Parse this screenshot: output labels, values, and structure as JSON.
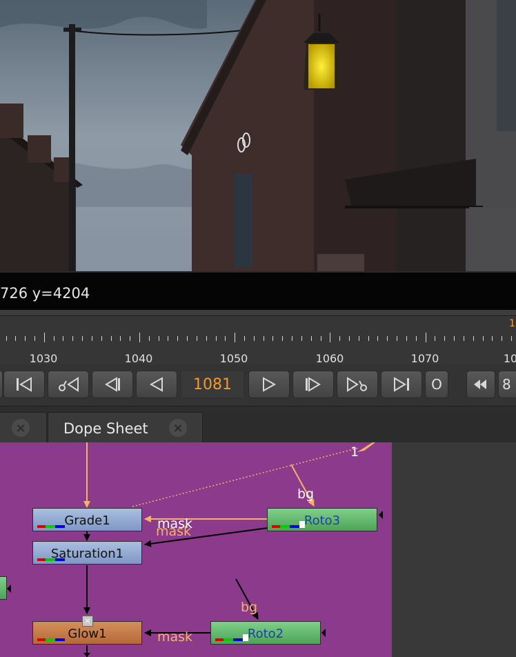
{
  "viewer": {
    "coordinate_readout": "726 y=4204"
  },
  "timeline": {
    "labels": [
      "1030",
      "1040",
      "1050",
      "1060",
      "1070",
      "10"
    ],
    "corner_marker": "1"
  },
  "transport": {
    "current_frame": "1081",
    "o_button": "O",
    "step_value": "8",
    "buttons": [
      "first-frame",
      "prev-keyframe",
      "prev-frame-step",
      "play-backward",
      "play-forward",
      "next-frame-step",
      "next-keyframe",
      "last-frame",
      "o-button",
      "rewind",
      "step-value"
    ]
  },
  "tabs": {
    "dope_sheet": "Dope Sheet"
  },
  "node_graph": {
    "nodes": {
      "grade1": "Grade1",
      "saturation1": "Saturation1",
      "glow1": "Glow1",
      "roto3": "Roto3",
      "roto2": "Roto2"
    },
    "edge_labels": {
      "mask_white": "mask",
      "mask_orange": "mask",
      "mask_glow": "mask",
      "bg_roto3": "bg",
      "bg_roto2": "bg",
      "one": "1"
    },
    "colors": {
      "background": "#8b3a8c",
      "pipe_orange": "#f5b36a",
      "pipe_black": "#000000"
    }
  }
}
